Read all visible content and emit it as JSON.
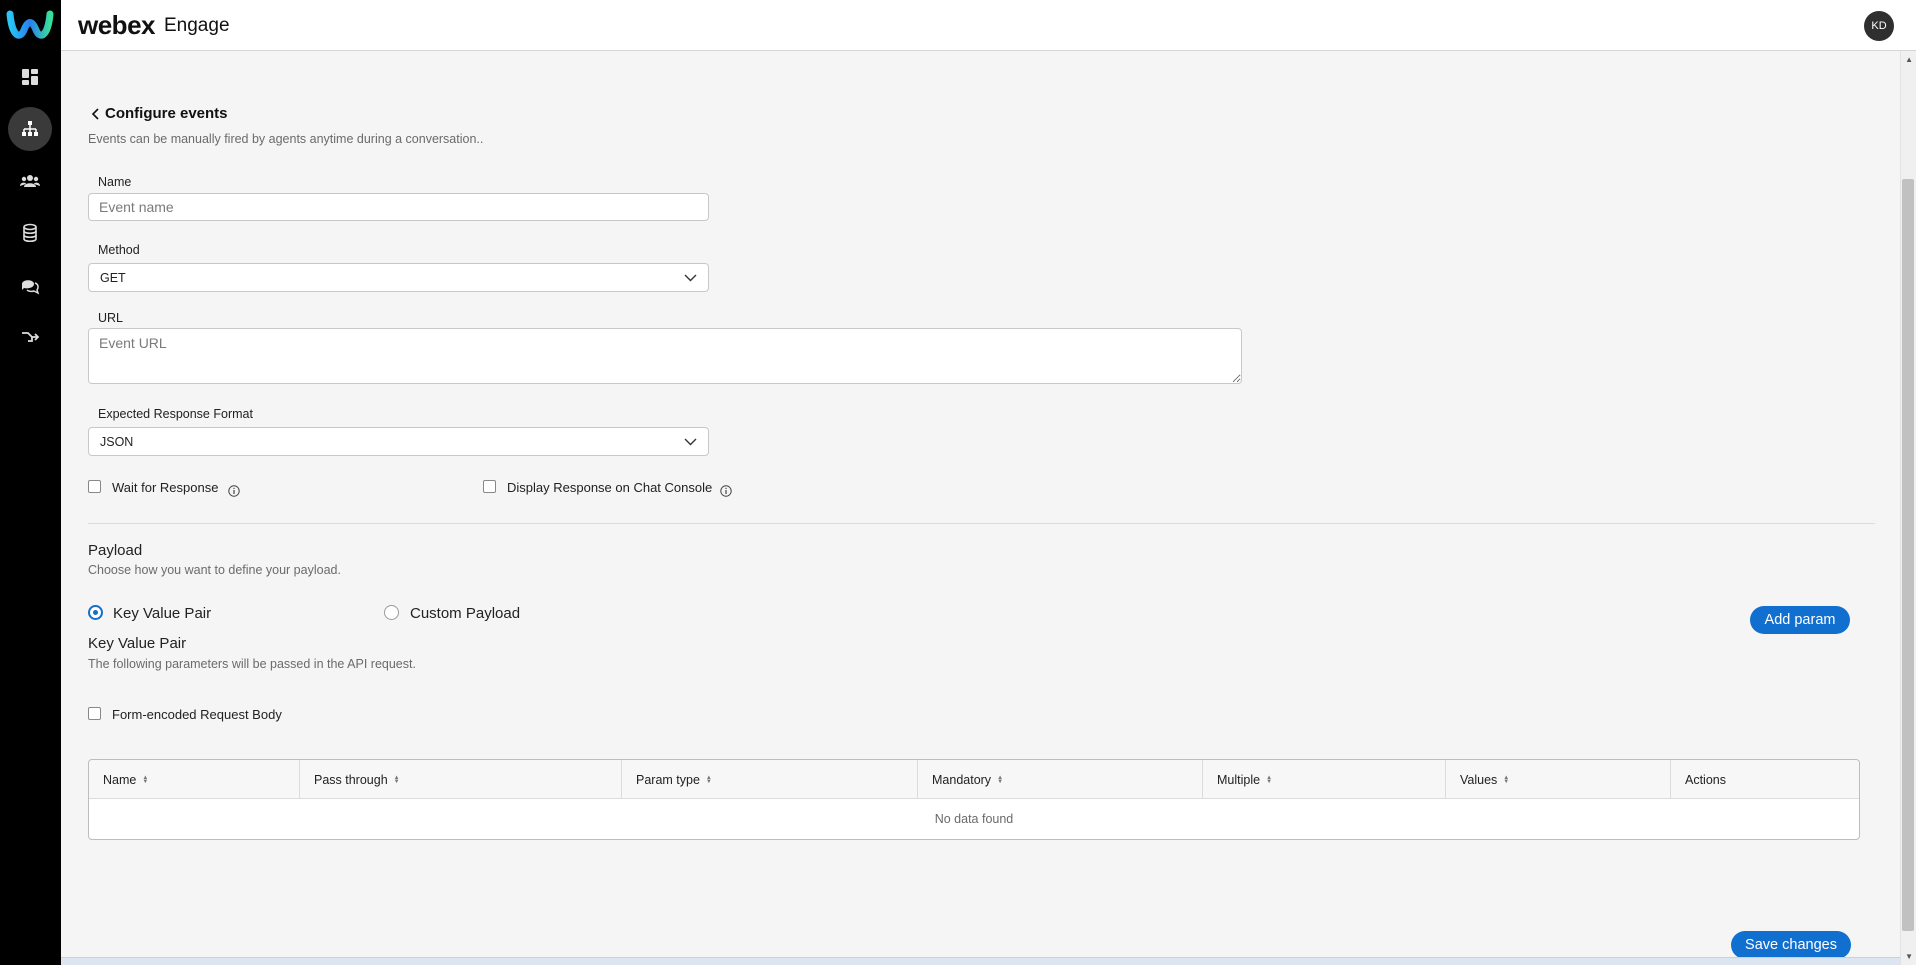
{
  "header": {
    "brand": "webex",
    "product": "Engage",
    "avatar_initials": "KD"
  },
  "nav": {
    "items": [
      "dashboard-icon",
      "hierarchy-icon",
      "team-icon",
      "database-icon",
      "chat-icon",
      "flow-icon"
    ],
    "active": "hierarchy-icon"
  },
  "page": {
    "title": "Configure events",
    "description": "Events can be manually fired by agents anytime during a conversation.."
  },
  "form": {
    "name_label": "Name",
    "name_placeholder": "Event name",
    "method_label": "Method",
    "method_value": "GET",
    "url_label": "URL",
    "url_placeholder": "Event URL",
    "format_label": "Expected Response Format",
    "format_value": "JSON",
    "wait_label": "Wait for Response",
    "display_label": "Display Response on Chat Console"
  },
  "payload": {
    "title": "Payload",
    "description": "Choose how you want to define your payload.",
    "option_kv": "Key Value Pair",
    "option_custom": "Custom Payload",
    "selected": "Key Value Pair",
    "add_param": "Add param",
    "kv_title": "Key Value Pair",
    "kv_description": "The following parameters will be passed in the API request.",
    "form_encoded_label": "Form-encoded Request Body"
  },
  "table": {
    "columns": [
      "Name",
      "Pass through",
      "Param type",
      "Mandatory",
      "Multiple",
      "Values",
      "Actions"
    ],
    "empty_text": "No data found"
  },
  "footer": {
    "save": "Save changes"
  },
  "colors": {
    "accent": "#1170cf",
    "nav_bg": "#000000"
  }
}
